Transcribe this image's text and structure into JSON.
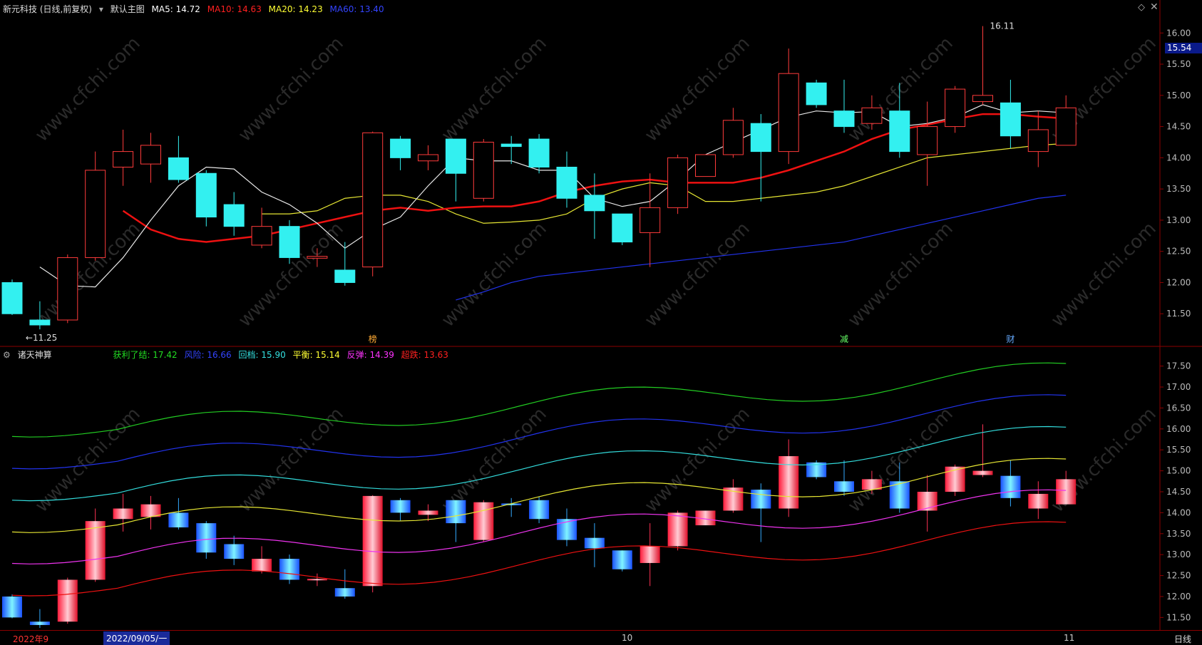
{
  "main_legend": {
    "title": "新元科技 (日线,前复权)",
    "chart_name": "默认主图",
    "ma5": "MA5: 14.72",
    "ma10": "MA10: 14.63",
    "ma20": "MA20: 14.23",
    "ma60": "MA60: 13.40",
    "colors": {
      "ma5": "#ffffff",
      "ma10": "#ff2020",
      "ma20": "#ffff33",
      "ma60": "#3344ff"
    }
  },
  "sub_legend": {
    "title": "诸天神算",
    "l1": "获利了结: 17.42",
    "l2": "风险: 16.66",
    "l3": "回档: 15.90",
    "l4": "平衡: 15.14",
    "l5": "反弹: 14.39",
    "l6": "超跌: 13.63"
  },
  "current_price_tag": "15.54",
  "annotations": {
    "high": "16.11",
    "low": "11.25",
    "m1": "榜",
    "m2": "减",
    "m3": "财"
  },
  "bottom_bar": {
    "d1": "2022年9",
    "d2": "2022/09/05/一",
    "d3": "10",
    "d4": "11",
    "period": "日线"
  },
  "chart_data": {
    "type": "candlestick",
    "price_axis_main": [
      11.5,
      12.0,
      12.5,
      13.0,
      13.5,
      14.0,
      14.5,
      15.0,
      15.5,
      16.0
    ],
    "price_axis_sub": [
      11.5,
      12.0,
      12.5,
      13.0,
      13.5,
      14.0,
      14.5,
      15.0,
      15.5,
      16.0,
      16.5,
      17.0,
      17.5
    ],
    "candles": [
      [
        12.0,
        11.5,
        12.05,
        11.48
      ],
      [
        11.4,
        11.32,
        11.7,
        11.25
      ],
      [
        11.4,
        12.4,
        12.45,
        11.35
      ],
      [
        12.4,
        13.8,
        14.1,
        12.35
      ],
      [
        13.85,
        14.1,
        14.45,
        13.55
      ],
      [
        13.9,
        14.2,
        14.4,
        13.6
      ],
      [
        14.0,
        13.65,
        14.35,
        13.6
      ],
      [
        13.75,
        13.05,
        13.8,
        12.9
      ],
      [
        13.25,
        12.9,
        13.45,
        12.75
      ],
      [
        12.6,
        12.9,
        13.2,
        12.55
      ],
      [
        12.9,
        12.4,
        13.0,
        12.3
      ],
      [
        12.39,
        12.42,
        12.55,
        12.25
      ],
      [
        12.2,
        12.0,
        12.65,
        11.95
      ],
      [
        12.25,
        14.4,
        14.42,
        12.1
      ],
      [
        14.3,
        14.0,
        14.35,
        13.8
      ],
      [
        13.95,
        14.05,
        14.2,
        13.8
      ],
      [
        14.3,
        13.75,
        14.25,
        13.3
      ],
      [
        13.35,
        14.25,
        14.3,
        13.3
      ],
      [
        14.22,
        14.18,
        14.35,
        13.9
      ],
      [
        14.3,
        13.85,
        14.38,
        13.75
      ],
      [
        13.85,
        13.35,
        14.1,
        13.2
      ],
      [
        13.4,
        13.15,
        13.75,
        12.7
      ],
      [
        13.1,
        12.65,
        13.1,
        12.6
      ],
      [
        12.8,
        13.2,
        13.75,
        12.25
      ],
      [
        13.2,
        14.0,
        14.05,
        13.1
      ],
      [
        13.7,
        14.05,
        14.05,
        13.7
      ],
      [
        14.05,
        14.6,
        14.8,
        14.0
      ],
      [
        14.55,
        14.1,
        14.7,
        13.3
      ],
      [
        14.1,
        15.35,
        15.75,
        13.9
      ],
      [
        15.2,
        14.85,
        15.25,
        14.8
      ],
      [
        14.75,
        14.5,
        15.25,
        14.4
      ],
      [
        14.55,
        14.8,
        15.0,
        14.45
      ],
      [
        14.75,
        14.1,
        15.2,
        14.0
      ],
      [
        14.05,
        14.5,
        14.9,
        13.55
      ],
      [
        14.5,
        15.1,
        15.15,
        14.4
      ],
      [
        14.9,
        15.0,
        16.11,
        14.85
      ],
      [
        14.88,
        14.35,
        15.25,
        14.15
      ],
      [
        14.1,
        14.45,
        14.75,
        13.85
      ],
      [
        14.2,
        14.8,
        15.0,
        14.2
      ]
    ],
    "ma5": [
      12.25,
      11.95,
      11.93,
      12.4,
      13.0,
      13.55,
      13.85,
      13.82,
      13.45,
      13.25,
      12.95,
      12.55,
      12.85,
      13.05,
      13.55,
      14.0,
      13.95,
      13.95,
      13.8,
      13.8,
      13.35,
      13.22,
      13.3,
      13.65,
      14.05,
      14.25,
      14.45,
      14.65,
      14.75,
      14.72,
      14.74,
      14.5,
      14.55,
      14.65,
      14.85,
      14.72,
      14.75,
      14.72
    ],
    "ma10": [
      13.15,
      12.85,
      12.7,
      12.65,
      12.7,
      12.75,
      12.85,
      12.95,
      13.05,
      13.15,
      13.2,
      13.15,
      13.2,
      13.22,
      13.22,
      13.3,
      13.45,
      13.55,
      13.62,
      13.65,
      13.6,
      13.6,
      13.6,
      13.68,
      13.8,
      13.95,
      14.1,
      14.3,
      14.45,
      14.53,
      14.62,
      14.7,
      14.7,
      14.66,
      14.63
    ],
    "ma20": [
      13.1,
      13.1,
      13.15,
      13.35,
      13.4,
      13.4,
      13.3,
      13.1,
      12.95,
      12.97,
      13.0,
      13.1,
      13.35,
      13.5,
      13.6,
      13.55,
      13.3,
      13.3,
      13.35,
      13.4,
      13.45,
      13.55,
      13.7,
      13.85,
      14.0,
      14.05,
      14.1,
      14.15,
      14.2,
      14.23
    ],
    "ma60": [
      11.72,
      11.85,
      12.0,
      12.1,
      12.15,
      12.2,
      12.25,
      12.3,
      12.35,
      12.4,
      12.45,
      12.5,
      12.55,
      12.6,
      12.65,
      12.75,
      12.85,
      12.95,
      13.05,
      13.15,
      13.25,
      13.35,
      13.4
    ]
  }
}
